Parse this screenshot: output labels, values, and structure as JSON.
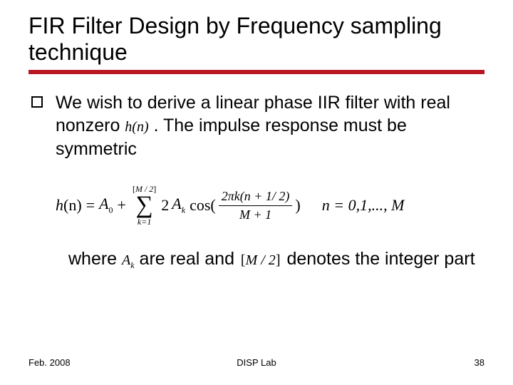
{
  "title": "FIR Filter Design by Frequency sampling technique",
  "bullet": {
    "pre": "We wish to derive a linear phase IIR filter with real nonzero ",
    "hn": "h(n)",
    "mid": " . The impulse response  must be symmetric"
  },
  "formula": {
    "lhs_h": "h",
    "lhs_arg": "(n)",
    "eq": "=",
    "A": "A",
    "zero": "0",
    "plus": "+",
    "sum_upper_open": "[",
    "sum_upper_expr": "M / 2",
    "sum_upper_close": "]",
    "sum_lower": "k=1",
    "two": "2",
    "Ak_A": "A",
    "Ak_k": "k",
    "cos": "cos(",
    "num_left": "2πk(n + 1/ 2)",
    "den": "M + 1",
    "close": ")",
    "range": "n = 0,1,..., M"
  },
  "where": {
    "w": "where  ",
    "Ak_A": "A",
    "Ak_k": "k",
    "mid": "  are real and ",
    "br_open": "[",
    "br_expr": "M / 2",
    "br_close": "]",
    "post": "  denotes the integer part"
  },
  "footer": {
    "left": "Feb. 2008",
    "center": "DISP Lab",
    "right": "38"
  }
}
